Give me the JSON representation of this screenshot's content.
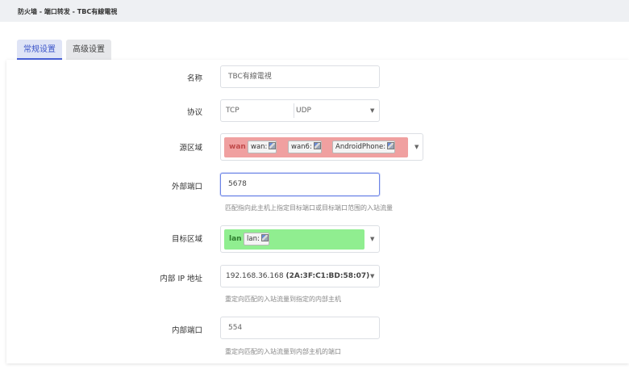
{
  "breadcrumb": "防火墙 - 端口转发 - TBC有線電視",
  "tabs": [
    {
      "label": "常规设置",
      "active": true
    },
    {
      "label": "高级设置",
      "active": false
    }
  ],
  "form": {
    "name": {
      "label": "名称",
      "value": "TBC有線電視"
    },
    "protocol": {
      "label": "协议",
      "value1": "TCP",
      "value2": "UDP"
    },
    "source_zone": {
      "label": "源区域",
      "zone": "wan",
      "networks": [
        "wan:",
        "wan6:",
        "AndroidPhone:"
      ],
      "color": "#f0a0a0"
    },
    "external_port": {
      "label": "外部端口",
      "value": "5678",
      "help": "匹配指向此主机上指定目标端口或目标端口范围的入站流量"
    },
    "dest_zone": {
      "label": "目标区域",
      "zone": "lan",
      "networks": [
        "lan:"
      ],
      "color": "#90ee90"
    },
    "internal_ip": {
      "label": "内部 IP 地址",
      "value": "192.168.36.168",
      "mac": "(2A:3F:C1:BD:58:07)",
      "help": "重定向匹配的入站流量到指定的内部主机"
    },
    "internal_port": {
      "label": "内部端口",
      "value": "554",
      "help": "重定向匹配的入站流量到内部主机的端口"
    }
  },
  "icons": {
    "caret": "caret-down-icon",
    "network": "network-icon"
  },
  "colors": {
    "accent": "#4a62d8",
    "focus_border": "#6c84e6"
  }
}
